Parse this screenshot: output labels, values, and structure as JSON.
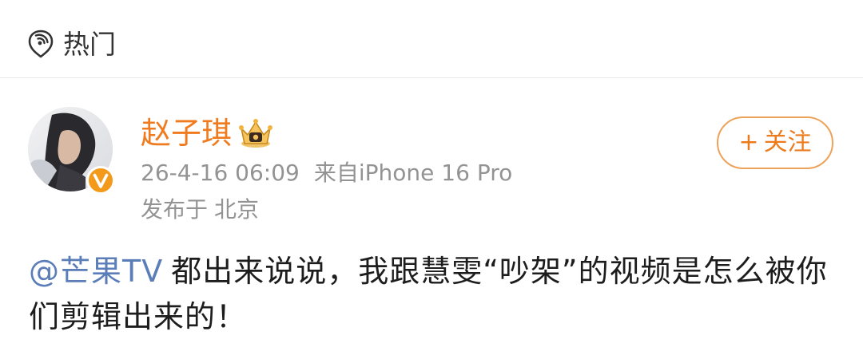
{
  "header": {
    "icon": "hot-topic-icon",
    "label": "热门"
  },
  "post": {
    "author": {
      "name": "赵子琪",
      "badge_icon": "crown-icon",
      "verified_icon": "verified-v-icon",
      "avatar_icon": "user-avatar"
    },
    "time": "26-4-16 06:09",
    "source": "来自iPhone 16 Pro",
    "location_prefix": "发布于",
    "location": "北京",
    "follow_label": "关注",
    "follow_plus": "+",
    "mention": "@芒果TV",
    "text": "都出来说说，我跟慧雯“吵架”的视频是怎么被你们剪辑出来的！"
  },
  "colors": {
    "name": "#f07a1e",
    "follow_border": "#eda25a",
    "follow_text": "#eb7b1d",
    "mention": "#5b7db8",
    "meta": "#939393",
    "body": "#1d1d1d"
  }
}
